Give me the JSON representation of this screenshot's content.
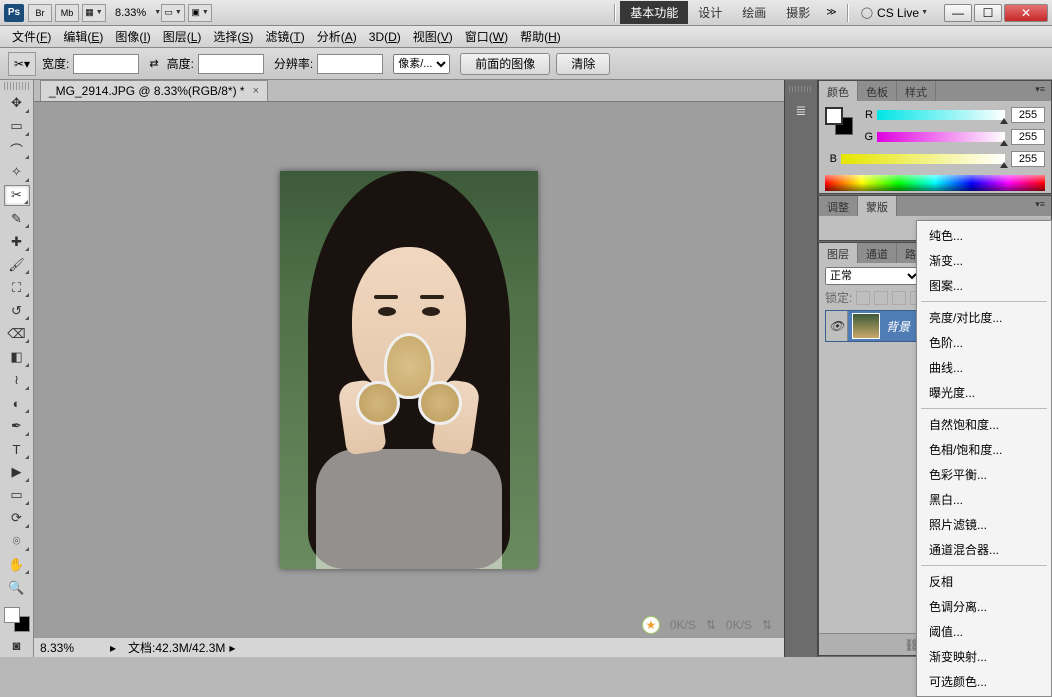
{
  "title_bar": {
    "ps_label": "Ps",
    "badges": [
      "Br",
      "Mb"
    ],
    "zoom": "8.33%",
    "workspace_tabs": [
      "基本功能",
      "设计",
      "绘画",
      "摄影"
    ],
    "active_workspace": 0,
    "cs_live": "CS Live"
  },
  "menu": [
    {
      "label": "文件",
      "accel": "F"
    },
    {
      "label": "编辑",
      "accel": "E"
    },
    {
      "label": "图像",
      "accel": "I"
    },
    {
      "label": "图层",
      "accel": "L"
    },
    {
      "label": "选择",
      "accel": "S"
    },
    {
      "label": "滤镜",
      "accel": "T"
    },
    {
      "label": "分析",
      "accel": "A"
    },
    {
      "label": "3D",
      "accel": "D"
    },
    {
      "label": "视图",
      "accel": "V"
    },
    {
      "label": "窗口",
      "accel": "W"
    },
    {
      "label": "帮助",
      "accel": "H"
    }
  ],
  "options": {
    "width_label": "宽度:",
    "height_label": "高度:",
    "resolution_label": "分辨率:",
    "unit_select": "像素/...",
    "front_image": "前面的图像",
    "clear": "清除",
    "width": "",
    "height": "",
    "resolution": ""
  },
  "doc": {
    "tab_title": "_MG_2914.JPG @ 8.33%(RGB/8*) *",
    "zoom_display": "8.33%",
    "file_size_label": "文档:",
    "file_size": "42.3M/42.3M",
    "sync_labels": [
      "0K/S",
      "0K/S"
    ]
  },
  "color_panel": {
    "tabs": [
      "颜色",
      "色板",
      "样式"
    ],
    "channels": [
      {
        "lab": "R",
        "val": "255"
      },
      {
        "lab": "G",
        "val": "255"
      },
      {
        "lab": "B",
        "val": "255"
      }
    ]
  },
  "adjust_panel": {
    "tabs": [
      "调整",
      "蒙版"
    ]
  },
  "layers_panel": {
    "tabs": [
      "图层",
      "通道",
      "路径"
    ],
    "blend_mode": "正常",
    "lock_label": "锁定:",
    "layer_name": "背景"
  },
  "context_menu": {
    "group1": [
      "纯色...",
      "渐变...",
      "图案..."
    ],
    "group2": [
      "亮度/对比度...",
      "色阶...",
      "曲线...",
      "曝光度..."
    ],
    "group3": [
      "自然饱和度...",
      "色相/饱和度...",
      "色彩平衡...",
      "黑白...",
      "照片滤镜...",
      "通道混合器..."
    ],
    "group4": [
      "反相",
      "色调分离...",
      "阈值...",
      "渐变映射...",
      "可选颜色..."
    ]
  }
}
